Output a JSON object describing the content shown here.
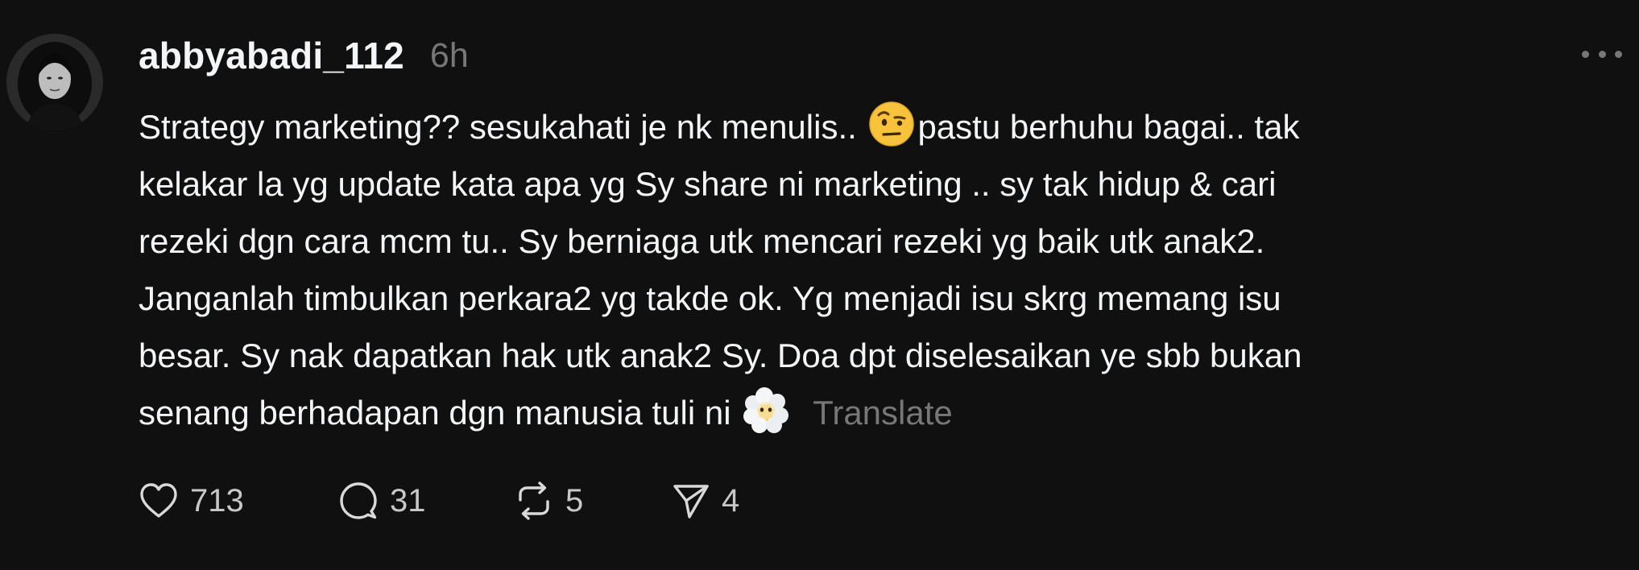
{
  "post": {
    "username": "abbyabadi_112",
    "time": "6h",
    "text_lines": [
      "Strategy marketing?? sesukahati je nk menulis.. ",
      "pastu berhuhu bagai.. tak",
      "kelakar la yg update kata apa yg Sy share ni marketing .. sy tak hidup & cari",
      "rezeki dgn cara mcm tu.. Sy berniaga utk mencari rezeki yg baik utk anak2.",
      "Janganlah timbulkan perkara2 yg takde ok. Yg menjadi isu skrg memang isu",
      "besar. Sy nak dapatkan hak utk anak2 Sy. Doa dpt diselesaikan ye sbb bukan",
      "senang berhadapan dgn manusia tuli ni "
    ],
    "emojis": [
      "face-with-raised-eyebrow-emoji",
      "face-in-clouds-emoji"
    ],
    "translate_label": "Translate"
  },
  "actions": {
    "likes": "713",
    "replies": "31",
    "reposts": "5",
    "shares": "4"
  },
  "colors": {
    "background": "#101010",
    "primary_text": "#f3f5f7",
    "secondary_text": "#777777",
    "emoji_yellow": "#f7c33c"
  },
  "icons": {
    "more": "more-horizontal-icon",
    "like": "heart-icon",
    "reply": "comment-bubble-icon",
    "repost": "repost-arrows-icon",
    "share": "send-paper-plane-icon"
  }
}
